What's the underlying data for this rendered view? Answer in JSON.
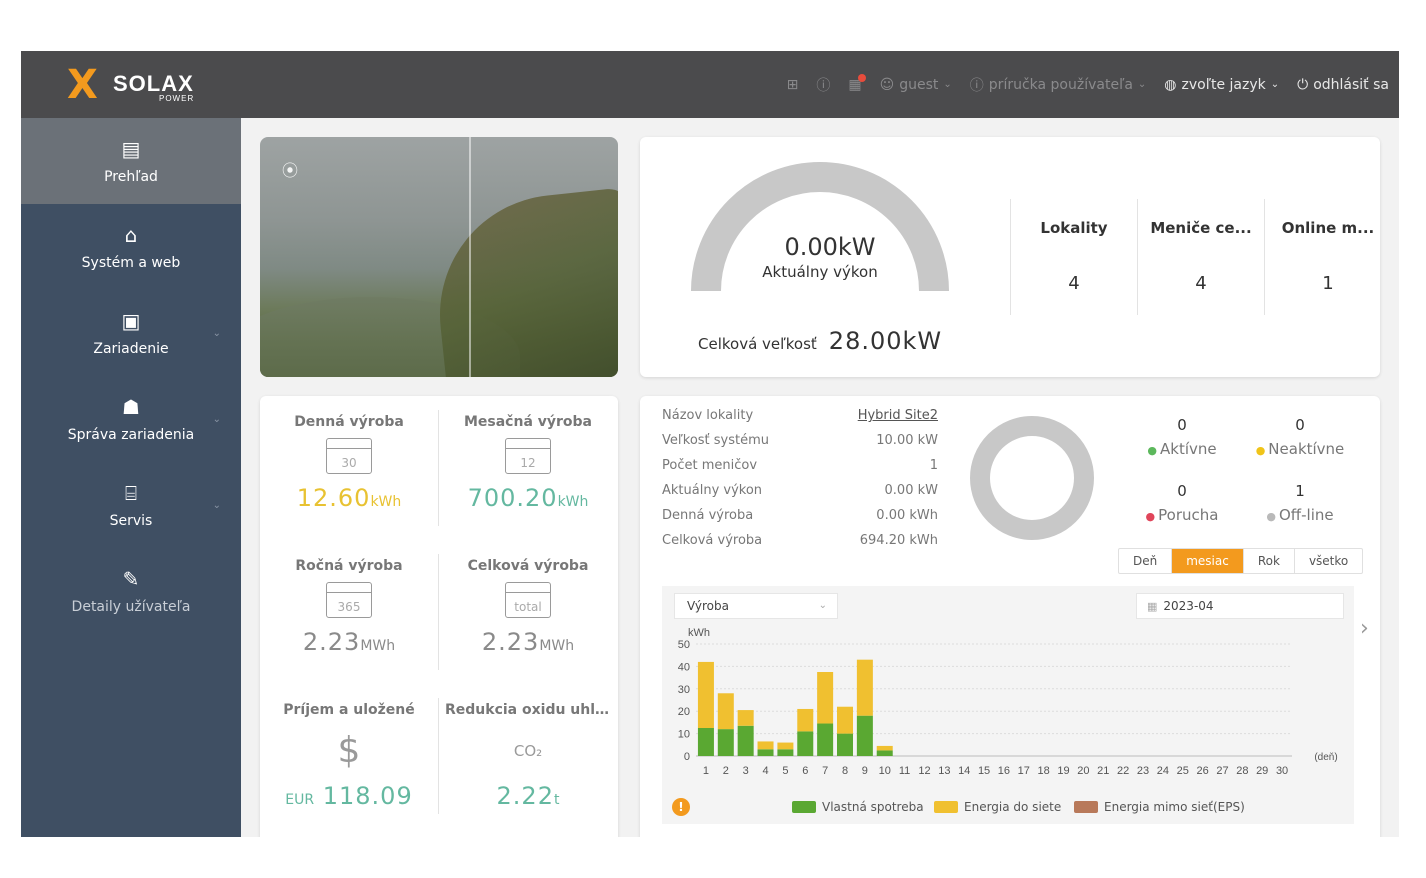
{
  "header": {
    "brand": "SOLAX",
    "brand_sub": "POWER",
    "nav": {
      "user": "guest",
      "manual": "príručka používateľa",
      "language": "zvoľte jazyk",
      "logout": "odhlásiť sa"
    },
    "icons": [
      "grid-icon",
      "info-icon",
      "building-icon",
      "user-icon",
      "globe-icon",
      "power-icon"
    ]
  },
  "sidebar": {
    "items": [
      {
        "label": "Prehľad",
        "icon": "document-icon",
        "active": true
      },
      {
        "label": "Systém a web",
        "icon": "home-icon"
      },
      {
        "label": "Zariadenie",
        "icon": "device-icon"
      },
      {
        "label": "Správa zariadenia",
        "icon": "router-icon"
      },
      {
        "label": "Servis",
        "icon": "tool-icon"
      },
      {
        "label": "Detaily užívateľa",
        "icon": "pen-icon"
      }
    ]
  },
  "power": {
    "current_value": "0.00kW",
    "current_label": "Aktuálny výkon",
    "total_label": "Celková veľkosť",
    "total_value": "28.00kW",
    "stats": [
      {
        "label": "Lokality",
        "value": "4"
      },
      {
        "label": "Meniče ce...",
        "value": "4"
      },
      {
        "label": "Online m...",
        "value": "1"
      }
    ]
  },
  "production": {
    "daily": {
      "label": "Denná výroba",
      "cal": "30",
      "value": "12.60",
      "unit": "kWh"
    },
    "monthly": {
      "label": "Mesačná výroba",
      "cal": "12",
      "value": "700.20",
      "unit": "kWh"
    },
    "yearly": {
      "label": "Ročná výroba",
      "cal": "365",
      "value": "2.23",
      "unit": "MWh"
    },
    "total": {
      "label": "Celková výroba",
      "cal": "total",
      "value": "2.23",
      "unit": "MWh"
    },
    "income": {
      "label": "Príjem a uložené",
      "currency": "EUR",
      "value": "118.09",
      "icon": "coins-icon"
    },
    "co2": {
      "label": "Redukcia oxidu uhli...",
      "value": "2.22",
      "unit": "t",
      "icon": "co2-icon",
      "icon_text": "CO₂"
    },
    "colors": {
      "yellow": "#e8c232",
      "green": "#64b8a0",
      "gray": "#8a8a8a"
    }
  },
  "site": {
    "info": [
      {
        "key": "Názov lokality",
        "value": "Hybrid Site2"
      },
      {
        "key": "Veľkosť systému",
        "value": "10.00 kW"
      },
      {
        "key": "Počet meničov",
        "value": "1"
      },
      {
        "key": "Aktuálny výkon",
        "value": "0.00 kW"
      },
      {
        "key": "Denná výroba",
        "value": "0.00 kWh"
      },
      {
        "key": "Celková výroba",
        "value": "694.20 kWh"
      }
    ],
    "status": {
      "active": {
        "count": "0",
        "label": "Aktívne"
      },
      "inactive": {
        "count": "0",
        "label": "Neaktívne"
      },
      "fault": {
        "count": "0",
        "label": "Porucha"
      },
      "offline": {
        "count": "1",
        "label": "Off-line"
      }
    },
    "range_buttons": [
      "Deň",
      "mesiac",
      "Rok",
      "všetko"
    ],
    "range_active": "mesiac",
    "select_value": "Výroba",
    "date_value": "2023-04"
  },
  "chart_data": {
    "type": "bar",
    "stacked": true,
    "ylabel": "kWh",
    "xlabel": "(deň)",
    "ylim": [
      0,
      50
    ],
    "yticks": [
      0,
      10,
      20,
      30,
      40,
      50
    ],
    "categories": [
      "1",
      "2",
      "3",
      "4",
      "5",
      "6",
      "7",
      "8",
      "9",
      "10",
      "11",
      "12",
      "13",
      "14",
      "15",
      "16",
      "17",
      "18",
      "19",
      "20",
      "21",
      "22",
      "23",
      "24",
      "25",
      "26",
      "27",
      "28",
      "29",
      "30"
    ],
    "series": [
      {
        "name": "Vlastná spotreba",
        "color": "#5aa832",
        "values": [
          12.5,
          12.0,
          13.5,
          3.0,
          3.0,
          11.0,
          14.5,
          10.0,
          18.0,
          2.5,
          0,
          0,
          0,
          0,
          0,
          0,
          0,
          0,
          0,
          0,
          0,
          0,
          0,
          0,
          0,
          0,
          0,
          0,
          0,
          0
        ]
      },
      {
        "name": "Energia do siete",
        "color": "#f0c030",
        "values": [
          29.5,
          16.0,
          7.0,
          3.5,
          3.0,
          10.0,
          23.0,
          12.0,
          25.0,
          2.0,
          0,
          0,
          0,
          0,
          0,
          0,
          0,
          0,
          0,
          0,
          0,
          0,
          0,
          0,
          0,
          0,
          0,
          0,
          0,
          0
        ]
      },
      {
        "name": "Energia mimo sieť(EPS)",
        "color": "#b8795a",
        "values": [
          0,
          0,
          0,
          0,
          0,
          0,
          0,
          0,
          0,
          0,
          0,
          0,
          0,
          0,
          0,
          0,
          0,
          0,
          0,
          0,
          0,
          0,
          0,
          0,
          0,
          0,
          0,
          0,
          0,
          0
        ]
      }
    ]
  }
}
